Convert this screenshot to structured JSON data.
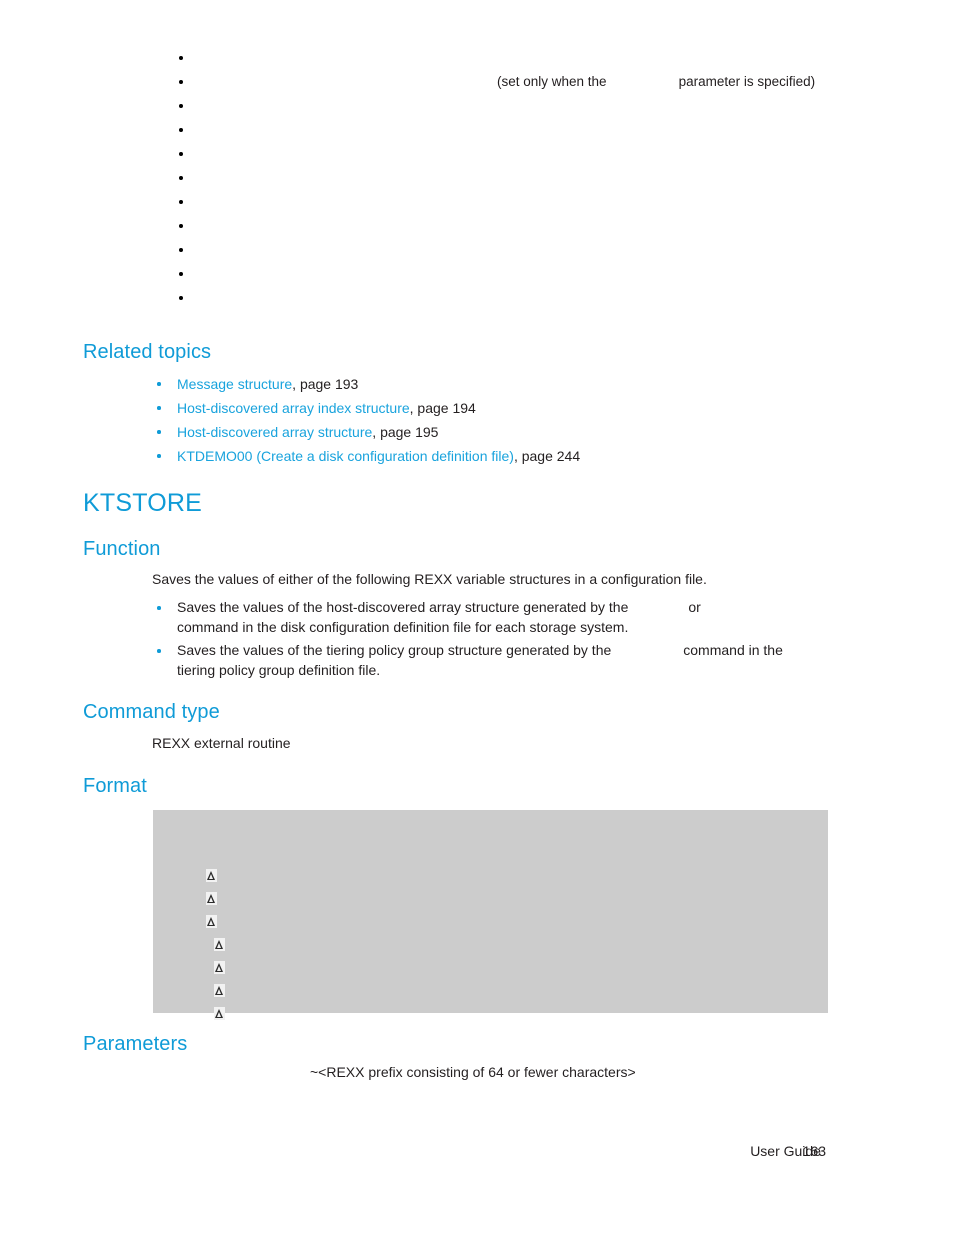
{
  "document": {
    "page_number": "163",
    "footer_label": "User Guide"
  },
  "top_list": {
    "items": [
      {
        "text": "",
        "note": ""
      },
      {
        "text": "",
        "note_prefix": "(set only when the",
        "note_suffix": "parameter is specified)"
      },
      {
        "text": "",
        "note": ""
      },
      {
        "text": "",
        "note": ""
      },
      {
        "text": "",
        "note": ""
      },
      {
        "text": "",
        "note": ""
      },
      {
        "text": "",
        "note": ""
      },
      {
        "text": "",
        "note": ""
      },
      {
        "text": "",
        "note": ""
      },
      {
        "text": "",
        "note": ""
      },
      {
        "text": "",
        "note": ""
      }
    ]
  },
  "related_topics": {
    "heading": "Related topics",
    "items": [
      {
        "link": "Message structure",
        "page": ", page 193"
      },
      {
        "link": "Host-discovered array index structure",
        "page": ", page 194"
      },
      {
        "link": "Host-discovered array structure",
        "page": ", page 195"
      },
      {
        "link": "KTDEMO00 (Create a disk configuration definition file)",
        "page": ", page 244"
      }
    ]
  },
  "command": {
    "title": "KTSTORE",
    "function": {
      "heading": "Function",
      "intro": "Saves the values of either of the following REXX variable structures in a configuration file.",
      "bullets": [
        {
          "line1_a": "Saves the values of the host-discovered array structure generated by the",
          "line1_b": "or",
          "line2": "command in the disk configuration definition file for each storage system."
        },
        {
          "line1_a": "Saves the values of the tiering policy group structure generated by the",
          "line1_b": "command in the",
          "line2": "tiering policy group definition file."
        }
      ]
    },
    "command_type": {
      "heading": "Command type",
      "value": "REXX external routine"
    },
    "format": {
      "heading": "Format",
      "space_symbol": "Δ",
      "lines": [
        {
          "indent": 0,
          "spaces": 0,
          "text": ""
        },
        {
          "indent": 0,
          "spaces": 0,
          "text": ""
        },
        {
          "indent": 10,
          "spaces": 1,
          "text": ""
        },
        {
          "indent": 10,
          "spaces": 1,
          "text": ""
        },
        {
          "indent": 10,
          "spaces": 1,
          "text": ""
        },
        {
          "indent": 18,
          "spaces": 1,
          "text": ""
        },
        {
          "indent": 18,
          "spaces": 1,
          "text": ""
        },
        {
          "indent": 18,
          "spaces": 1,
          "text": ""
        },
        {
          "indent": 18,
          "spaces": 1,
          "text": ""
        }
      ]
    },
    "parameters": {
      "heading": "Parameters",
      "description": "~<REXX prefix consisting of 64 or fewer characters>"
    }
  },
  "colors": {
    "heading_blue": "#0f9bd7",
    "link_blue": "#19a3dd",
    "body_black": "#231f20",
    "code_bg": "#cccccc"
  }
}
